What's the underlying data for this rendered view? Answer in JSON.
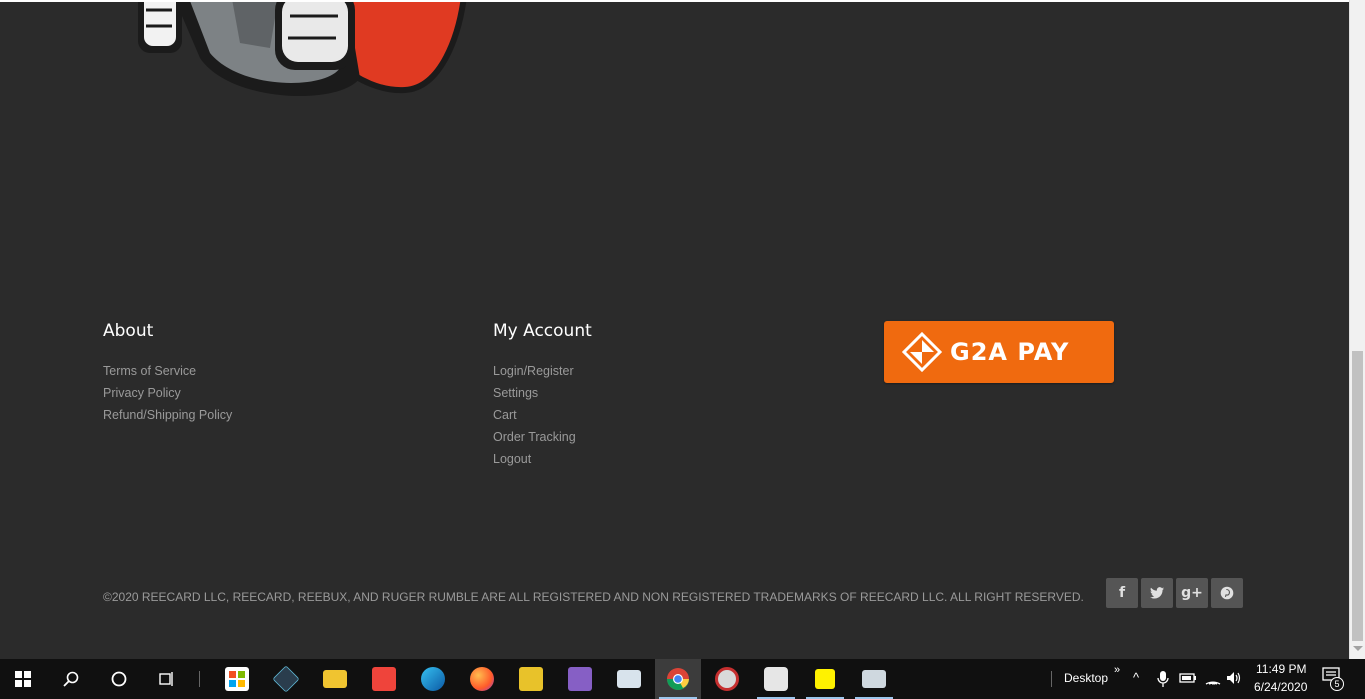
{
  "footer": {
    "about": {
      "title": "About",
      "links": [
        "Terms of Service",
        "Privacy Policy",
        "Refund/Shipping Policy"
      ]
    },
    "account": {
      "title": "My Account",
      "links": [
        "Login/Register",
        "Settings",
        "Cart",
        "Order Tracking",
        "Logout"
      ]
    },
    "payment": {
      "label": "G2A PAY",
      "color": "#f06a0f"
    },
    "copyright": "©2020 REECARD LLC, REECARD, REEBUX, AND RUGER RUMBLE ARE ALL REGISTERED AND NON REGISTERED TRADEMARKS OF REECARD LLC. ALL RIGHT RESERVED.",
    "social": [
      {
        "icon": "facebook-icon",
        "glyph": "f"
      },
      {
        "icon": "twitter-icon",
        "glyph": "🐦"
      },
      {
        "icon": "google-plus-icon",
        "glyph": "g+"
      },
      {
        "icon": "pinterest-icon",
        "glyph": "p"
      }
    ]
  },
  "taskbar": {
    "desktop_label": "Desktop",
    "time": "11:49 PM",
    "date": "6/24/2020",
    "notification_count": "5"
  },
  "colors": {
    "background": "#2b2b2b",
    "accent": "#f06a0f",
    "taskbar": "#101010"
  }
}
